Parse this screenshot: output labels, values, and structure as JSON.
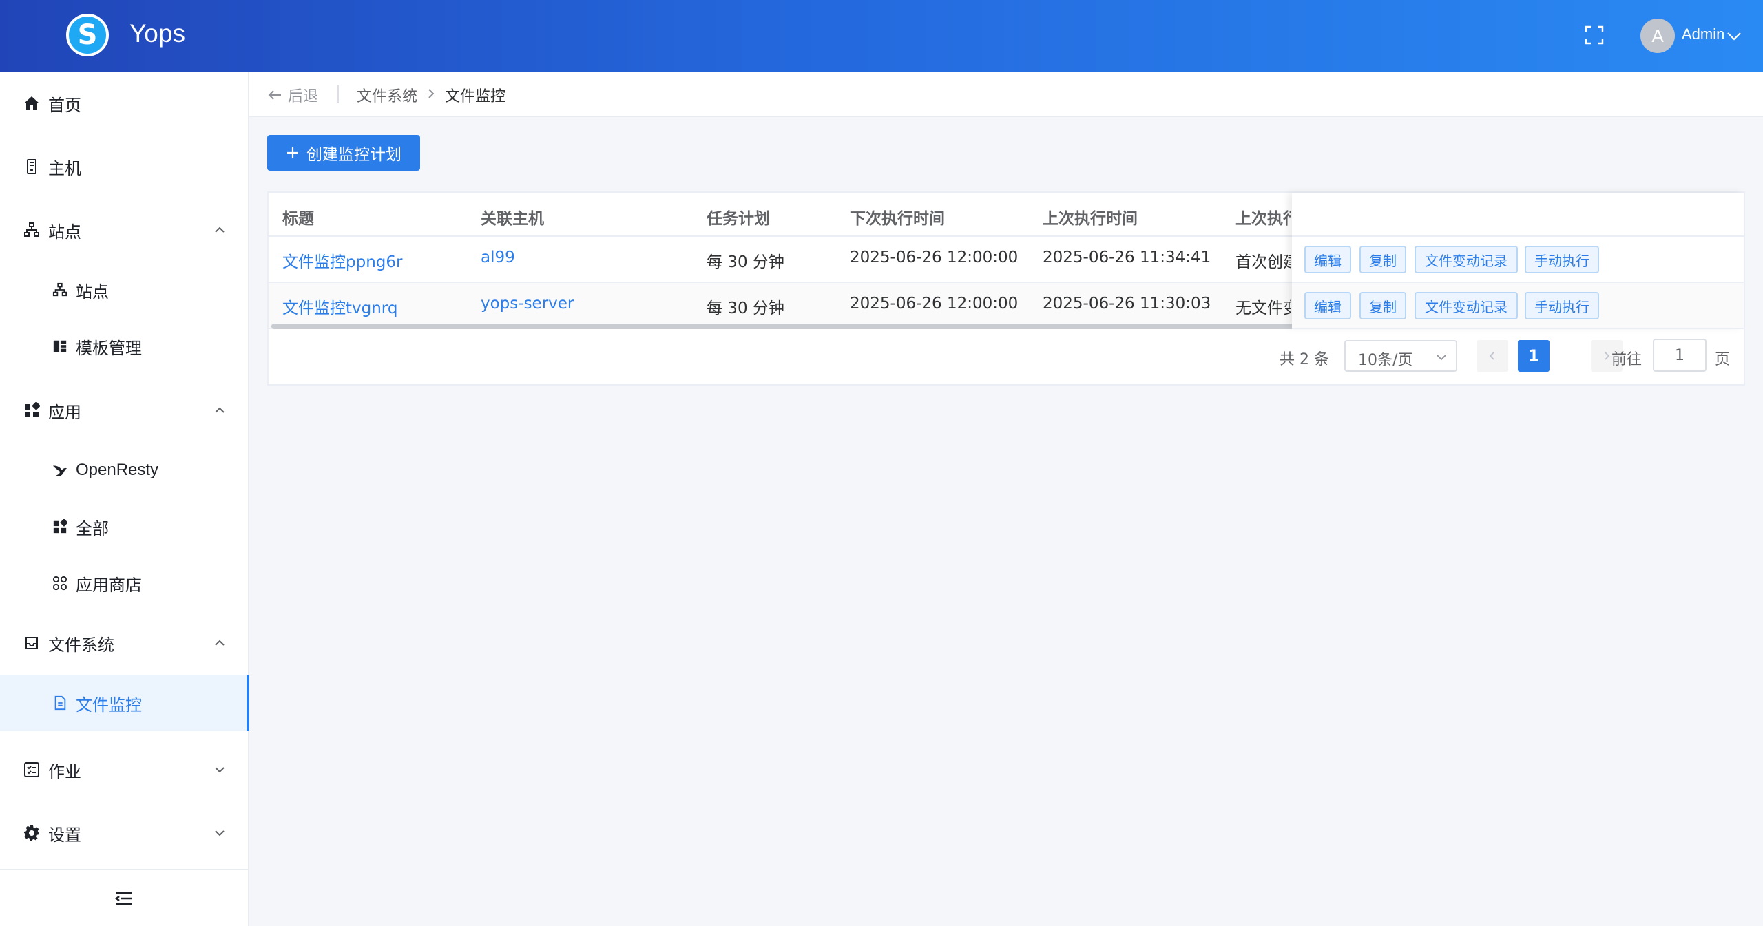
{
  "app": {
    "title": "Yops",
    "logo_glyph": "S"
  },
  "user": {
    "avatar_letter": "A",
    "name": "Admin"
  },
  "sidebar": {
    "home": "首页",
    "host": "主机",
    "site": "站点",
    "site_sub_site": "站点",
    "site_sub_template": "模板管理",
    "app": "应用",
    "app_sub_openresty": "OpenResty",
    "app_sub_all": "全部",
    "app_sub_store": "应用商店",
    "fs": "文件系统",
    "fs_sub_monitor": "文件监控",
    "job": "作业",
    "settings": "设置"
  },
  "breadcrumb": {
    "back": "后退",
    "parent": "文件系统",
    "current": "文件监控"
  },
  "toolbar": {
    "create_label": "创建监控计划"
  },
  "table": {
    "columns": [
      "标题",
      "关联主机",
      "任务计划",
      "下次执行时间",
      "上次执行时间",
      "上次执行"
    ],
    "rows": [
      {
        "title": "文件监控ppng6r",
        "host": "al99",
        "schedule": "每 30 分钟",
        "next": "2025-06-26 12:00:00",
        "last": "2025-06-26 11:34:41",
        "result": "首次创建"
      },
      {
        "title": "文件监控tvgnrq",
        "host": "yops-server",
        "schedule": "每 30 分钟",
        "next": "2025-06-26 12:00:00",
        "last": "2025-06-26 11:30:03",
        "result": "无文件变动"
      }
    ],
    "actions": {
      "edit": "编辑",
      "copy": "复制",
      "records": "文件变动记录",
      "run": "手动执行"
    }
  },
  "pagination": {
    "total": "共 2 条",
    "page_size": "10条/页",
    "current_page": "1",
    "goto_label": "前往",
    "goto_value": "1",
    "goto_suffix": "页"
  },
  "colors": {
    "primary": "#2b7de9",
    "header_start": "#2145b8",
    "header_end": "#2a8af3"
  }
}
